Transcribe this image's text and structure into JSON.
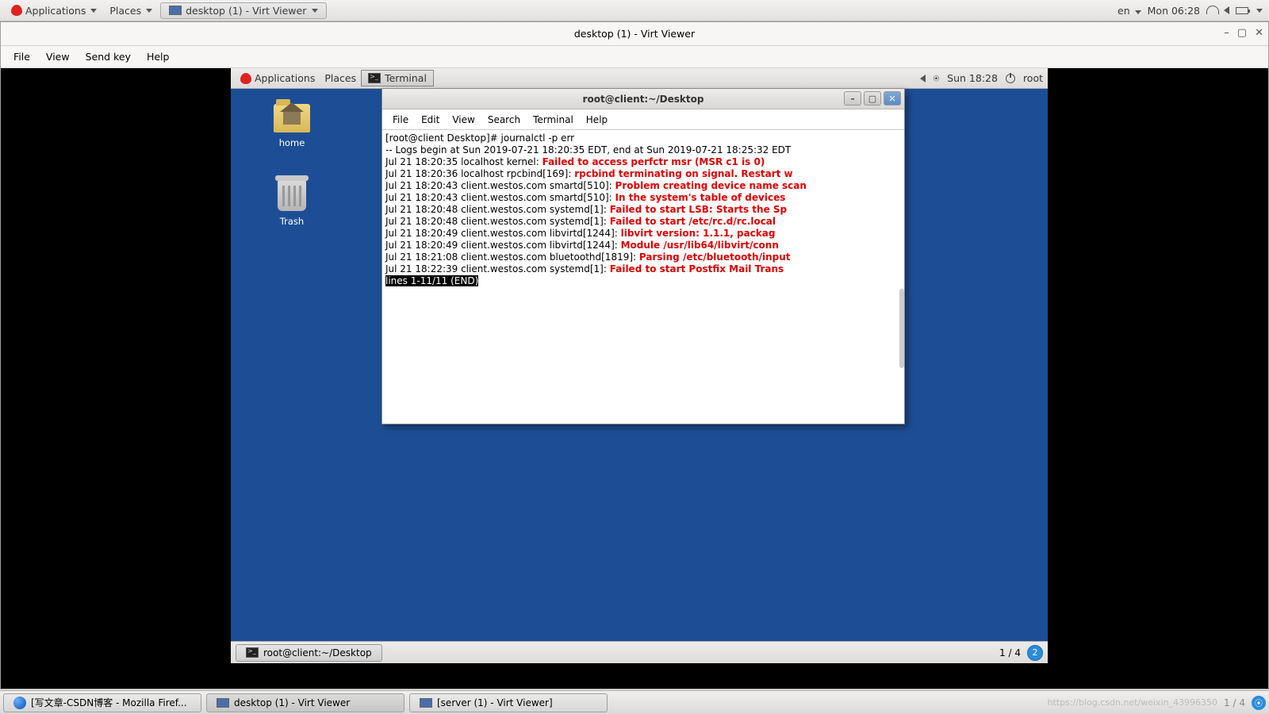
{
  "outer": {
    "applications": "Applications",
    "places": "Places",
    "task_label": "desktop (1) - Virt Viewer",
    "lang": "en",
    "clock": "Mon 06:28"
  },
  "vv": {
    "title": "desktop (1) - Virt Viewer",
    "menu": {
      "file": "File",
      "view": "View",
      "sendkey": "Send key",
      "help": "Help"
    }
  },
  "guest": {
    "applications": "Applications",
    "places": "Places",
    "terminal_task": "Terminal",
    "clock": "Sun 18:28",
    "user": "root",
    "icons": {
      "home": "home",
      "trash": "Trash"
    },
    "bottom_task": "root@client:~/Desktop",
    "workspace": "1 / 4",
    "notif_count": "2"
  },
  "term": {
    "title": "root@client:~/Desktop",
    "menu": {
      "file": "File",
      "edit": "Edit",
      "view": "View",
      "search": "Search",
      "terminal": "Terminal",
      "help": "Help"
    },
    "lines": [
      {
        "pre": "[root@client Desktop]# journalctl -p err",
        "err": ""
      },
      {
        "pre": "-- Logs begin at Sun 2019-07-21 18:20:35 EDT, end at Sun 2019-07-21 18:25:32 EDT",
        "err": ""
      },
      {
        "pre": "Jul 21 18:20:35 localhost kernel: ",
        "err": "Failed to access perfctr msr (MSR c1 is 0)"
      },
      {
        "pre": "Jul 21 18:20:36 localhost rpcbind[169]: ",
        "err": "rpcbind terminating on signal. Restart w"
      },
      {
        "pre": "Jul 21 18:20:43 client.westos.com smartd[510]: ",
        "err": "Problem creating device name scan"
      },
      {
        "pre": "Jul 21 18:20:43 client.westos.com smartd[510]: ",
        "err": "In the system's table of devices"
      },
      {
        "pre": "Jul 21 18:20:48 client.westos.com systemd[1]: ",
        "err": "Failed to start LSB: Starts the Sp"
      },
      {
        "pre": "Jul 21 18:20:48 client.westos.com systemd[1]: ",
        "err": "Failed to start /etc/rc.d/rc.local"
      },
      {
        "pre": "Jul 21 18:20:49 client.westos.com libvirtd[1244]: ",
        "err": "libvirt version: 1.1.1, packag"
      },
      {
        "pre": "Jul 21 18:20:49 client.westos.com libvirtd[1244]: ",
        "err": "Module /usr/lib64/libvirt/conn"
      },
      {
        "pre": "Jul 21 18:21:08 client.westos.com bluetoothd[1819]: ",
        "err": "Parsing /etc/bluetooth/input"
      },
      {
        "pre": "Jul 21 18:22:39 client.westos.com systemd[1]: ",
        "err": "Failed to start Postfix Mail Trans"
      }
    ],
    "end": "lines 1-11/11 (END)"
  },
  "outer_bottom": {
    "t1": "[写文章-CSDN博客 - Mozilla Firef...",
    "t2": "desktop (1) - Virt Viewer",
    "t3": "[server (1) - Virt Viewer]",
    "watermark": "https://blog.csdn.net/weixin_43996350",
    "pager": "1 / 4"
  }
}
